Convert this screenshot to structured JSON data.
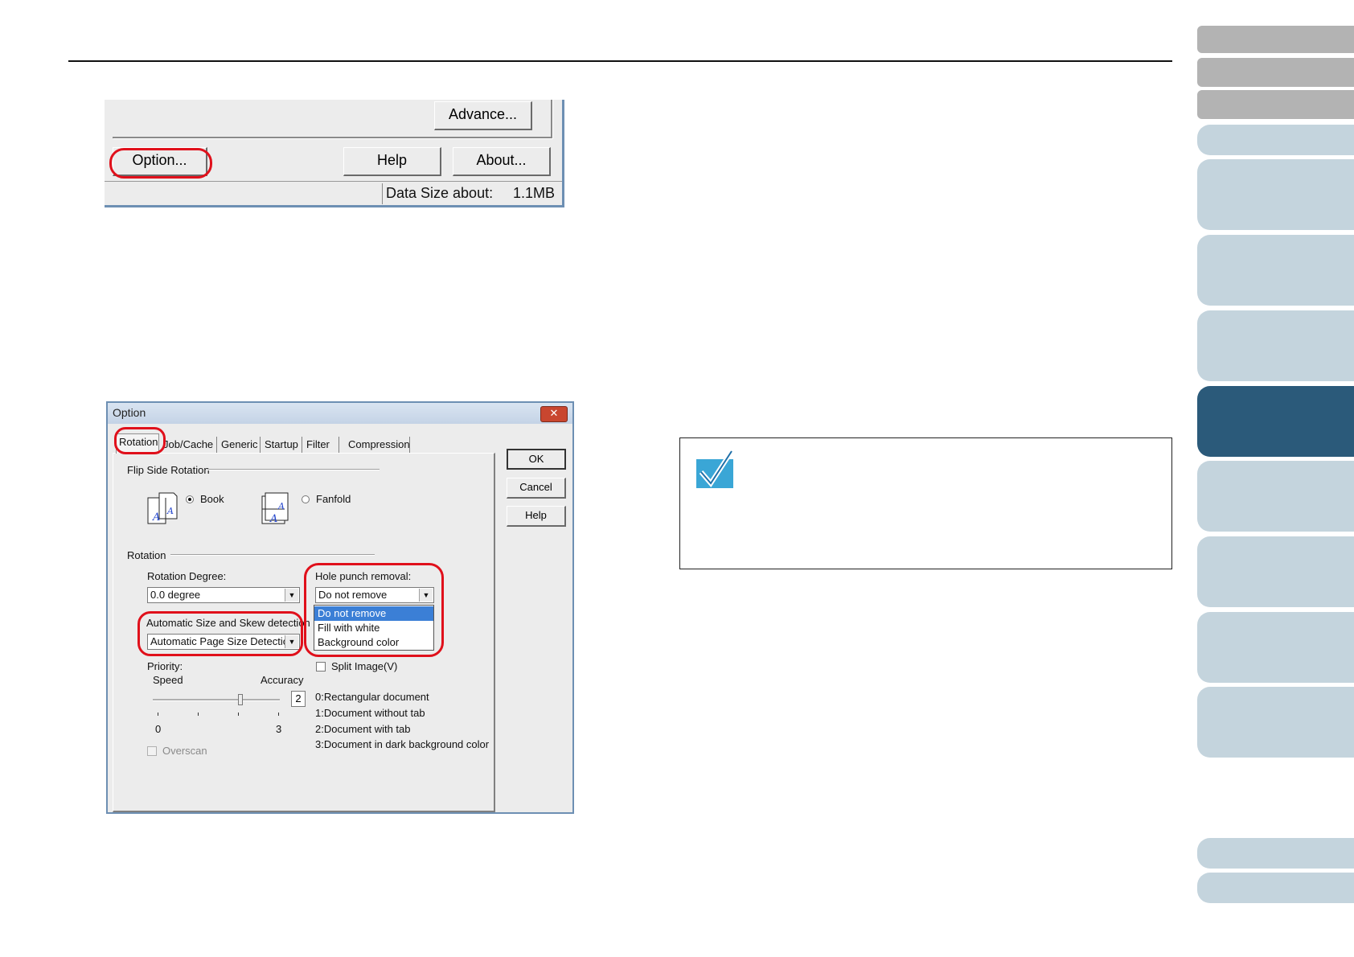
{
  "top_fragment": {
    "advance_label": "Advance...",
    "option_label": "Option...",
    "help_label": "Help",
    "about_label": "About...",
    "status_label": "Data Size about:",
    "status_value": "1.1MB"
  },
  "option_dialog": {
    "title": "Option",
    "close_glyph": "✕",
    "tabs": [
      "Rotation",
      "Job/Cache",
      "Generic",
      "Startup",
      "Filter",
      "Compression"
    ],
    "buttons": {
      "ok": "OK",
      "cancel": "Cancel",
      "help": "Help"
    },
    "flip_side_rotation": {
      "group_label": "Flip Side Rotation",
      "book_label": "Book",
      "fanfold_label": "Fanfold",
      "selected": "Book"
    },
    "rotation": {
      "group_label": "Rotation",
      "rotation_degree_label": "Rotation Degree:",
      "rotation_degree_value": "0.0 degree",
      "auto_size_label": "Automatic Size and Skew detection",
      "auto_size_value": "Automatic Page Size Detection",
      "hole_punch_label": "Hole punch removal:",
      "hole_punch_value": "Do not remove",
      "hole_punch_options": [
        "Do not remove",
        "Fill with white",
        "Background color"
      ],
      "split_image_label": "Split Image(V)",
      "priority_label": "Priority:",
      "speed_label": "Speed",
      "accuracy_label": "Accuracy",
      "priority_value": "2",
      "scale_min": "0",
      "scale_max": "3",
      "overscan_label": "Overscan",
      "document_types": [
        "0:Rectangular document",
        "1:Document without tab",
        "2:Document with tab",
        "3:Document in dark background color"
      ]
    }
  },
  "colors": {
    "highlight_ring": "#e0101b",
    "side_tab_active": "#2b5a7a",
    "side_tab_light": "#c4d4dd",
    "side_tab_gray": "#b3b3b3",
    "note_icon": "#3aa6d6"
  }
}
